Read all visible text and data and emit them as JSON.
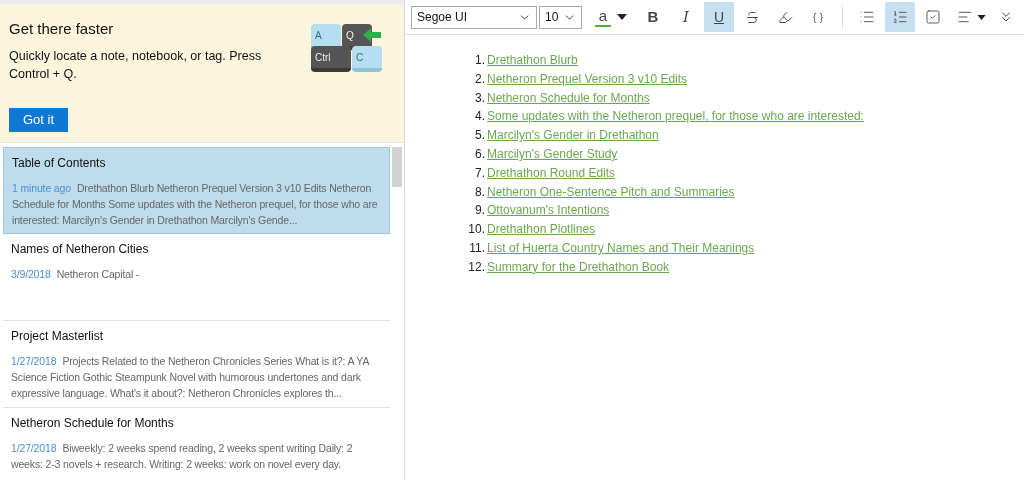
{
  "tip": {
    "title": "Get there faster",
    "message": "Quickly locate a note, notebook, or tag. Press Control + Q.",
    "button": "Got it",
    "keys": [
      {
        "label": "A",
        "kind": "light"
      },
      {
        "label": "Q",
        "kind": "dark"
      },
      {
        "label": "Ctrl",
        "kind": "dark"
      },
      {
        "label": "C",
        "kind": "light"
      }
    ]
  },
  "notes": [
    {
      "title": "Table of Contents",
      "date": "1 minute ago",
      "preview": "Drethathon Blurb Netheron Prequel Version 3 v10 Edits Netheron Schedule for Months Some updates with the Netheron prequel, for those who are interested: Marcilyn's Gender in Drethathon Marcilyn's Gende...",
      "selected": true
    },
    {
      "title": "Names of Netheron Cities",
      "date": "3/9/2018",
      "preview": "Netheron Capital -",
      "selected": false
    },
    {
      "title": "Project Masterlist",
      "date": "1/27/2018",
      "preview": "Projects Related to the Netheron Chronicles Series What is it?: A YA Science Fiction Gothic Steampunk Novel with humorous undertones and dark expressive language. What's it about?: Netheron Chronicles explores th...",
      "selected": false
    },
    {
      "title": "Netheron Schedule for Months",
      "date": "1/27/2018",
      "preview": "Biweekly: 2 weeks spend reading, 2 weeks spent writing Daily: 2 weeks: 2-3 novels + research. Writing: 2 weeks: work on novel every day.",
      "selected": false
    }
  ],
  "toolbar": {
    "font": "Segoe UI",
    "size": "10",
    "tools": [
      {
        "kind": "color",
        "label": "a"
      },
      {
        "kind": "caret"
      },
      {
        "kind": "bold",
        "label": "B",
        "selected": false
      },
      {
        "kind": "italic",
        "label": "I",
        "selected": false
      },
      {
        "kind": "underline",
        "label": "U",
        "selected": true
      },
      {
        "kind": "strike",
        "selected": false
      },
      {
        "kind": "highlight",
        "selected": false
      },
      {
        "kind": "code",
        "label": "{ }",
        "selected": false
      },
      {
        "kind": "divider"
      },
      {
        "kind": "bullets",
        "selected": false
      },
      {
        "kind": "numbers",
        "selected": true
      },
      {
        "kind": "checkbox",
        "selected": false
      },
      {
        "kind": "align"
      },
      {
        "kind": "more"
      }
    ]
  },
  "document": {
    "items": [
      {
        "number": "1.",
        "text": "Drethathon Blurb"
      },
      {
        "number": "2.",
        "text": "Netheron Prequel Version 3 v10 Edits"
      },
      {
        "number": "3.",
        "text": "Netheron Schedule for Months"
      },
      {
        "number": "4.",
        "text": "Some updates with the Netheron prequel, for those who are interested:"
      },
      {
        "number": "5.",
        "text": "Marcilyn's Gender in Drethathon"
      },
      {
        "number": "6.",
        "text": "Marcilyn's Gender Study"
      },
      {
        "number": "7.",
        "text": "Drethathon Round Edits"
      },
      {
        "number": "8.",
        "text": "Netheron One-Sentence Pitch and Summaries"
      },
      {
        "number": "9.",
        "text": "Ottovanum's Intentions"
      },
      {
        "number": "10.",
        "text": "Drethathon Plotlines"
      },
      {
        "number": "11.",
        "text": "List of Huerta Country Names and Their Meanings"
      },
      {
        "number": "12.",
        "text": "Summary for the Drethathon Book"
      }
    ]
  }
}
